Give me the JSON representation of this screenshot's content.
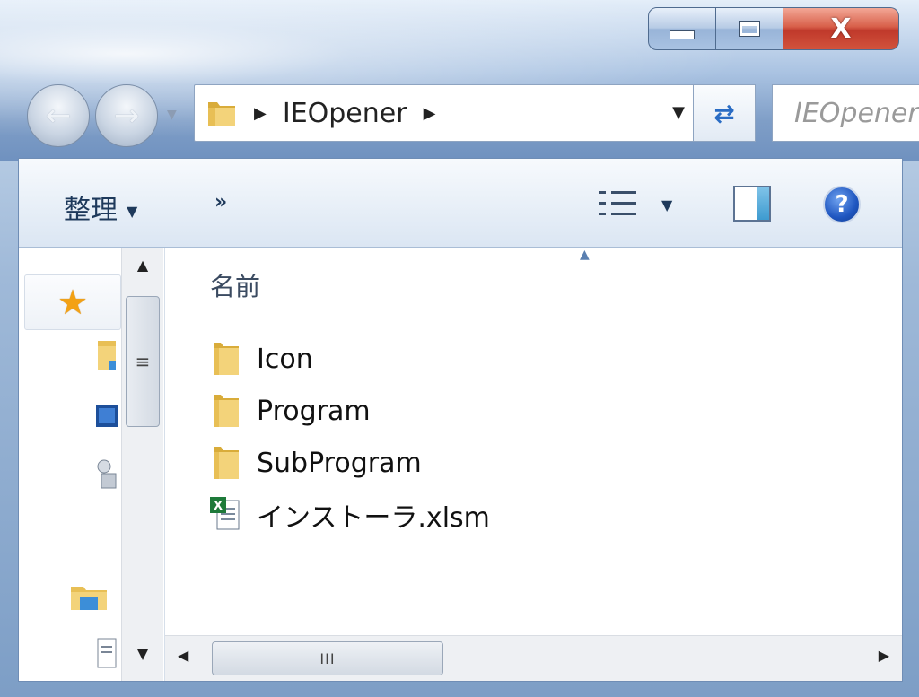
{
  "window": {
    "caption": {
      "minimize_icon": "minimize-icon",
      "maximize_icon": "maximize-icon",
      "close_glyph": "X"
    }
  },
  "navigation": {
    "back_icon": "arrow-left-icon",
    "forward_icon": "arrow-right-icon",
    "recent_dropdown_icon": "chevron-down-icon"
  },
  "address_bar": {
    "path": "IEOpener",
    "folder_icon": "folder-icon",
    "refresh_icon": "refresh-icon"
  },
  "search": {
    "placeholder": "IEOpener"
  },
  "toolbar": {
    "organize_label": "整理",
    "more_label": "»",
    "views_icon": "details-view-icon",
    "preview_pane_icon": "preview-pane-icon",
    "help_label": "?"
  },
  "nav_pane": {
    "favorites_icon": "star-icon"
  },
  "file_list": {
    "column_name_header": "名前",
    "items": [
      {
        "name": "Icon",
        "type": "folder"
      },
      {
        "name": "Program",
        "type": "folder"
      },
      {
        "name": "SubProgram",
        "type": "folder"
      },
      {
        "name": "インストーラ.xlsm",
        "type": "excel"
      }
    ]
  },
  "scrollbars": {
    "thumb_grip": "III"
  },
  "colors": {
    "close_button": "#c0392b",
    "accent": "#1f56c0",
    "folder": "#e9c35a"
  }
}
